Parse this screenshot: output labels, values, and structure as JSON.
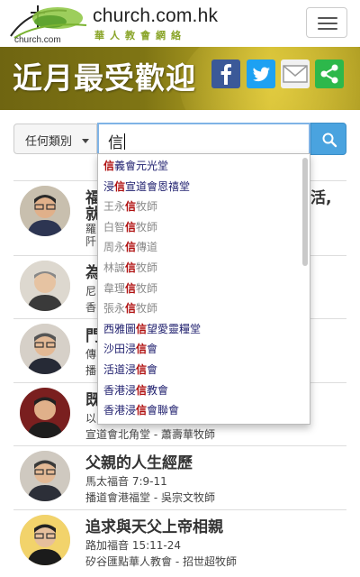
{
  "header": {
    "site_name": "church.com.hk",
    "site_sub": "華人教會網絡",
    "logo_text": "church.com"
  },
  "banner": {
    "title": "近月最受歡迎",
    "share": [
      "facebook-icon",
      "twitter-icon",
      "email-icon",
      "share-icon"
    ]
  },
  "search": {
    "category_label": "任何類別",
    "query": "信"
  },
  "dropdown": {
    "items": [
      {
        "before": "",
        "match": "信",
        "after": "義會元光堂",
        "style": "dark"
      },
      {
        "before": "浸",
        "match": "信",
        "after": "宣道會恩禧堂",
        "style": "dark"
      },
      {
        "before": "王永",
        "match": "信",
        "after": "牧師",
        "style": "grey"
      },
      {
        "before": "白智",
        "match": "信",
        "after": "牧師",
        "style": "grey"
      },
      {
        "before": "周永",
        "match": "信",
        "after": "傳道",
        "style": "grey"
      },
      {
        "before": "林誠",
        "match": "信",
        "after": "牧師",
        "style": "grey"
      },
      {
        "before": "韋理",
        "match": "信",
        "after": "牧師",
        "style": "grey"
      },
      {
        "before": "張永",
        "match": "信",
        "after": "牧師",
        "style": "grey"
      },
      {
        "before": "西雅圖",
        "match": "信",
        "after": "望愛靈糧堂",
        "style": "dark"
      },
      {
        "before": "沙田浸",
        "match": "信",
        "after": "會",
        "style": "dark"
      },
      {
        "before": "活道浸",
        "match": "信",
        "after": "會",
        "style": "dark"
      },
      {
        "before": "香港浸",
        "match": "信",
        "after": "教會",
        "style": "dark"
      },
      {
        "before": "香港浸",
        "match": "信",
        "after": "會聯會",
        "style": "dark"
      }
    ]
  },
  "articles": [
    {
      "title": "福",
      "title_tail": "活,",
      "title2": "就",
      "ref": "羅",
      "church": "阡"
    },
    {
      "title": "為",
      "ref": "尼",
      "church": "香"
    },
    {
      "title": "門",
      "ref": "傳",
      "church": "播"
    },
    {
      "title": "既",
      "ref": "以",
      "church": "宣道會北角堂 - 蕭壽華牧師"
    },
    {
      "title": "父親的人生經歷",
      "ref": "馬太福音 7:9-11",
      "church": "播道會港福堂 - 吳宗文牧師"
    },
    {
      "title": "追求與天父上帝相親",
      "ref": "路加福音 15:11-24",
      "church": "矽谷匯點華人教會 - 招世超牧師"
    }
  ],
  "colors": {
    "accent_blue": "#4aa3df",
    "highlight_red": "#b01212",
    "brand_green": "#8aa52a"
  }
}
